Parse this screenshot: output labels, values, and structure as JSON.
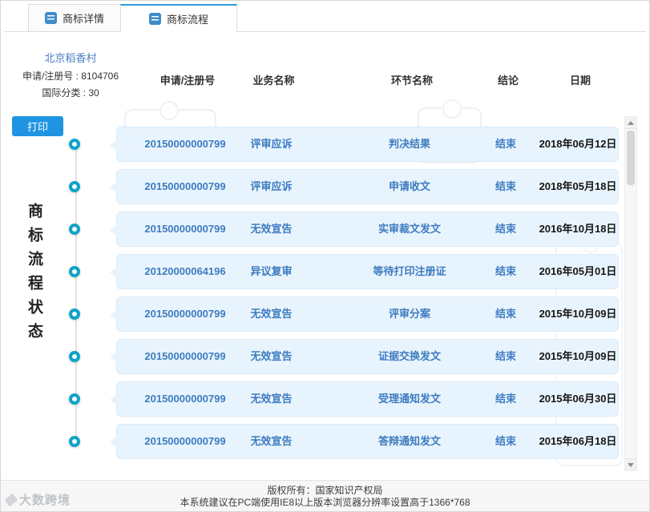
{
  "tabs": [
    {
      "label": "商标详情"
    },
    {
      "label": "商标流程"
    }
  ],
  "info": {
    "name": "北京稻香村",
    "reg_line": "申请/注册号 : 8104706",
    "class_line": "国际分类 : 30"
  },
  "print_button": "打印",
  "vertical_title": "商标流程状态",
  "table": {
    "headers": [
      "申请/注册号",
      "业务名称",
      "环节名称",
      "结论",
      "日期"
    ],
    "rows": [
      {
        "reg_no": "20150000000799",
        "business": "评审应诉",
        "step": "判决结果",
        "result": "结束",
        "date": "2018年06月12日"
      },
      {
        "reg_no": "20150000000799",
        "business": "评审应诉",
        "step": "申请收文",
        "result": "结束",
        "date": "2018年05月18日"
      },
      {
        "reg_no": "20150000000799",
        "business": "无效宣告",
        "step": "实审裁文发文",
        "result": "结束",
        "date": "2016年10月18日"
      },
      {
        "reg_no": "20120000064196",
        "business": "异议复审",
        "step": "等待打印注册证",
        "result": "结束",
        "date": "2016年05月01日"
      },
      {
        "reg_no": "20150000000799",
        "business": "无效宣告",
        "step": "评审分案",
        "result": "结束",
        "date": "2015年10月09日"
      },
      {
        "reg_no": "20150000000799",
        "business": "无效宣告",
        "step": "证据交换发文",
        "result": "结束",
        "date": "2015年10月09日"
      },
      {
        "reg_no": "20150000000799",
        "business": "无效宣告",
        "step": "受理通知发文",
        "result": "结束",
        "date": "2015年06月30日"
      },
      {
        "reg_no": "20150000000799",
        "business": "无效宣告",
        "step": "答辩通知发文",
        "result": "结束",
        "date": "2015年06月18日"
      }
    ]
  },
  "footer": {
    "line1": "版权所有：国家知识产权局",
    "line2": "本系统建议在PC端使用IE8以上版本浏览器分辨率设置高于1366*768"
  },
  "watermark": "大数跨境",
  "colors": {
    "accent": "#2e9bd8",
    "node": "#0fa3c8",
    "link_text": "#3d7bc0",
    "bubble_bg": "#e8f4fd",
    "print_button": "#2094e3"
  }
}
